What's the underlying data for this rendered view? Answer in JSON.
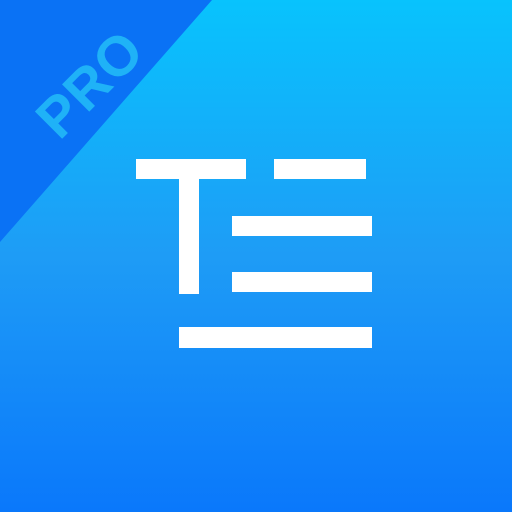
{
  "app_icon": {
    "badge_label": "PRO",
    "icon_name": "text-lines-icon",
    "colors": {
      "gradient_top": "#08C3FD",
      "gradient_mid": "#1E9CF6",
      "gradient_bottom": "#0A78FB",
      "corner_band": "#0A72F5",
      "badge_text": "#1FB2F7",
      "glyph": "#FFFFFF"
    }
  }
}
